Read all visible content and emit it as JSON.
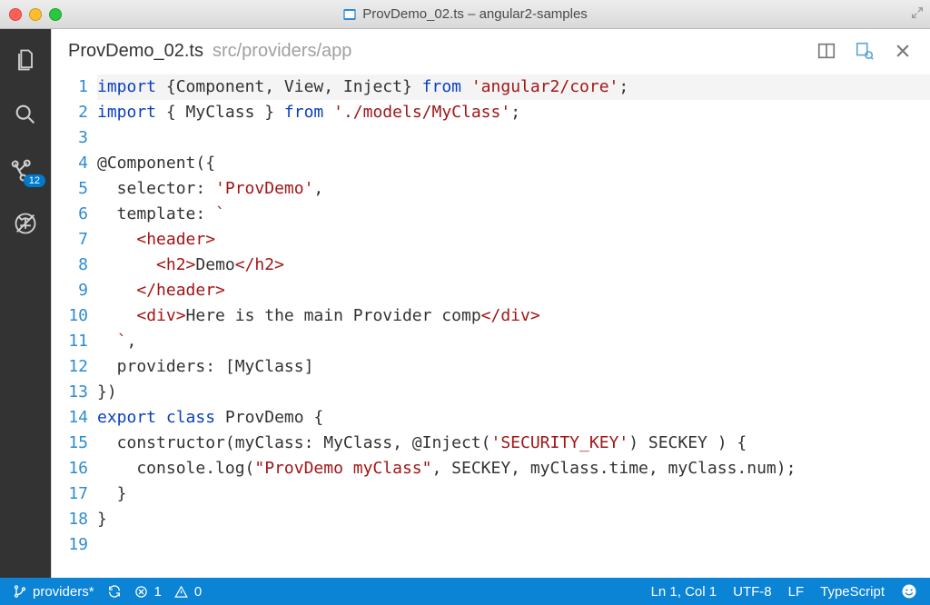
{
  "window": {
    "title": "ProvDemo_02.ts – angular2-samples"
  },
  "tab": {
    "filename": "ProvDemo_02.ts",
    "path": "src/providers/app"
  },
  "activity": {
    "git_badge": "12"
  },
  "code": {
    "lines": [
      {
        "n": "1",
        "segs": [
          {
            "t": "import",
            "c": "kw"
          },
          {
            "t": " {Component, View, Inject} "
          },
          {
            "t": "from",
            "c": "kw"
          },
          {
            "t": " "
          },
          {
            "t": "'angular2/core'",
            "c": "str"
          },
          {
            "t": ";"
          }
        ],
        "hl": true
      },
      {
        "n": "2",
        "segs": [
          {
            "t": "import",
            "c": "kw"
          },
          {
            "t": " { MyClass } "
          },
          {
            "t": "from",
            "c": "kw"
          },
          {
            "t": " "
          },
          {
            "t": "'./models/MyClass'",
            "c": "str"
          },
          {
            "t": ";"
          }
        ]
      },
      {
        "n": "3",
        "segs": []
      },
      {
        "n": "4",
        "segs": [
          {
            "t": "@Component({"
          }
        ]
      },
      {
        "n": "5",
        "segs": [
          {
            "t": "  selector: "
          },
          {
            "t": "'ProvDemo'",
            "c": "str"
          },
          {
            "t": ","
          }
        ]
      },
      {
        "n": "6",
        "segs": [
          {
            "t": "  template: "
          },
          {
            "t": "`",
            "c": "str"
          }
        ]
      },
      {
        "n": "7",
        "segs": [
          {
            "t": "    "
          },
          {
            "t": "<header>",
            "c": "tag"
          }
        ]
      },
      {
        "n": "8",
        "segs": [
          {
            "t": "      "
          },
          {
            "t": "<h2>",
            "c": "tag"
          },
          {
            "t": "Demo"
          },
          {
            "t": "</h2>",
            "c": "tag"
          }
        ]
      },
      {
        "n": "9",
        "segs": [
          {
            "t": "    "
          },
          {
            "t": "</header>",
            "c": "tag"
          }
        ]
      },
      {
        "n": "10",
        "segs": [
          {
            "t": "    "
          },
          {
            "t": "<div>",
            "c": "tag"
          },
          {
            "t": "Here is the main Provider comp"
          },
          {
            "t": "</div>",
            "c": "tag"
          }
        ]
      },
      {
        "n": "11",
        "segs": [
          {
            "t": "  "
          },
          {
            "t": "`",
            "c": "str"
          },
          {
            "t": ","
          }
        ]
      },
      {
        "n": "12",
        "segs": [
          {
            "t": "  providers: [MyClass]"
          }
        ]
      },
      {
        "n": "13",
        "segs": [
          {
            "t": "})"
          }
        ]
      },
      {
        "n": "14",
        "segs": [
          {
            "t": "export",
            "c": "kw"
          },
          {
            "t": " "
          },
          {
            "t": "class",
            "c": "kw"
          },
          {
            "t": " ProvDemo {"
          }
        ]
      },
      {
        "n": "15",
        "segs": [
          {
            "t": "  constructor(myClass: MyClass, @Inject("
          },
          {
            "t": "'SECURITY_KEY'",
            "c": "str"
          },
          {
            "t": ") SECKEY ) {"
          }
        ]
      },
      {
        "n": "16",
        "segs": [
          {
            "t": "    console.log("
          },
          {
            "t": "\"ProvDemo myClass\"",
            "c": "str"
          },
          {
            "t": ", SECKEY, myClass.time, myClass.num);"
          }
        ]
      },
      {
        "n": "17",
        "segs": [
          {
            "t": "  }"
          }
        ]
      },
      {
        "n": "18",
        "segs": [
          {
            "t": "}"
          }
        ]
      },
      {
        "n": "19",
        "segs": []
      }
    ]
  },
  "status": {
    "branch": "providers*",
    "errors": "1",
    "warnings": "0",
    "position": "Ln 1, Col 1",
    "encoding": "UTF-8",
    "eol": "LF",
    "language": "TypeScript"
  }
}
